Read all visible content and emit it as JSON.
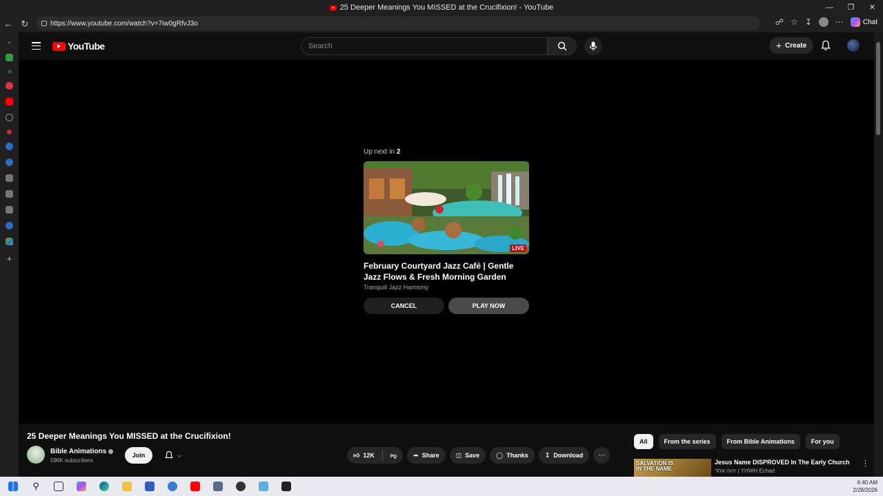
{
  "browser": {
    "window_title": "25 Deeper Meanings You MISSED at the Crucifixion! - YouTube",
    "url": "https://www.youtube.com/watch?v=7iw0gRfvJ3o",
    "chat_label": "Chat"
  },
  "header": {
    "logo_text": "YouTube",
    "search_placeholder": "Search",
    "create_label": "Create"
  },
  "up_next": {
    "label": "Up next in",
    "countdown": "2",
    "video_title": "February Courtyard Jazz Café | Gentle Jazz Flows & Fresh Morning Garden Ambience f...",
    "channel": "Tranquill Jazz Harmony",
    "badge": "LIVE",
    "cancel_label": "CANCEL",
    "play_label": "PLAY NOW"
  },
  "video": {
    "title": "25 Deeper Meanings You MISSED at the Crucifixion!",
    "channel_name": "Bible Animations",
    "subscribers": "598K subscribers",
    "join_label": "Join",
    "likes": "12K",
    "share_label": "Share",
    "save_label": "Save",
    "thanks_label": "Thanks",
    "download_label": "Download"
  },
  "chips": [
    "All",
    "From the series",
    "From Bible Animations",
    "For you"
  ],
  "recommendation": {
    "thumb_text_1": "SALVATION IS",
    "thumb_text_2": "IN THE NAME",
    "title": "Jesus Name DISPROVED In The Early Church",
    "channel": "יהוה אחד | YHWH Echad"
  },
  "taskbar": {
    "time": "6:40 AM",
    "date": "2/28/2026"
  },
  "colors": {
    "youtube_red": "#ff0000",
    "background": "#0f0f0f",
    "live_red": "#cc0000"
  }
}
